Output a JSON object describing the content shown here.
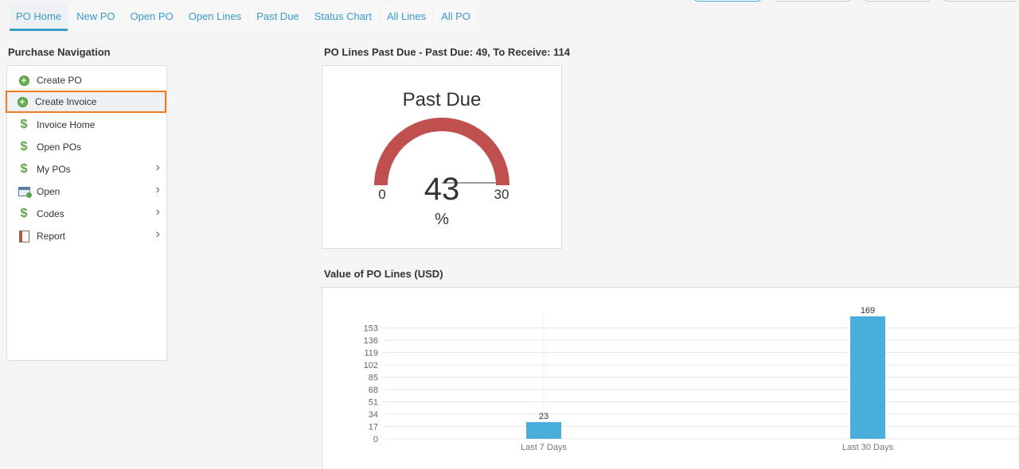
{
  "tabs": [
    {
      "label": "PO Home",
      "active": true
    },
    {
      "label": "New PO"
    },
    {
      "label": "Open PO"
    },
    {
      "label": "Open Lines"
    },
    {
      "label": "Past Due"
    },
    {
      "label": "Status Chart"
    },
    {
      "label": "All Lines"
    },
    {
      "label": "All PO"
    }
  ],
  "sidebar": {
    "title": "Purchase Navigation",
    "items": [
      {
        "label": "Create PO",
        "icon": "plus-circle-icon"
      },
      {
        "label": "Create Invoice",
        "icon": "plus-circle-icon",
        "selected": true
      },
      {
        "label": "Invoice Home",
        "icon": "dollar-icon"
      },
      {
        "label": "Open POs",
        "icon": "dollar-icon"
      },
      {
        "label": "My POs",
        "icon": "dollar-icon",
        "submenu": true
      },
      {
        "label": "Open",
        "icon": "open-window-icon",
        "submenu": true
      },
      {
        "label": "Codes",
        "icon": "dollar-icon",
        "submenu": true
      },
      {
        "label": "Report",
        "icon": "report-icon",
        "submenu": true
      }
    ]
  },
  "gauge_section": {
    "title": "PO Lines Past Due - Past Due: 49, To Receive: 114"
  },
  "value_section": {
    "title": "Value of PO Lines (USD)"
  },
  "colors": {
    "accent": "#3a9ac9",
    "gauge_fill": "#c0504d",
    "bar": "#4aaedb",
    "selected_border": "#f27a22"
  },
  "chart_data": [
    {
      "type": "gauge",
      "title": "Past Due",
      "value": 43,
      "min": 0,
      "max": 30,
      "unit": "%",
      "min_label": "0",
      "max_label": "30",
      "value_label": "43"
    },
    {
      "type": "bar",
      "categories": [
        "Last 7 Days",
        "Last 30 Days"
      ],
      "values": [
        23,
        169
      ],
      "value_labels": [
        "23",
        "169"
      ],
      "ylim": [
        0,
        169
      ],
      "yticks": [
        "0",
        "17",
        "34",
        "51",
        "68",
        "85",
        "102",
        "119",
        "136",
        "153"
      ],
      "ytick_values": [
        0,
        17,
        34,
        51,
        68,
        85,
        102,
        119,
        136,
        153
      ],
      "grid": true
    }
  ]
}
